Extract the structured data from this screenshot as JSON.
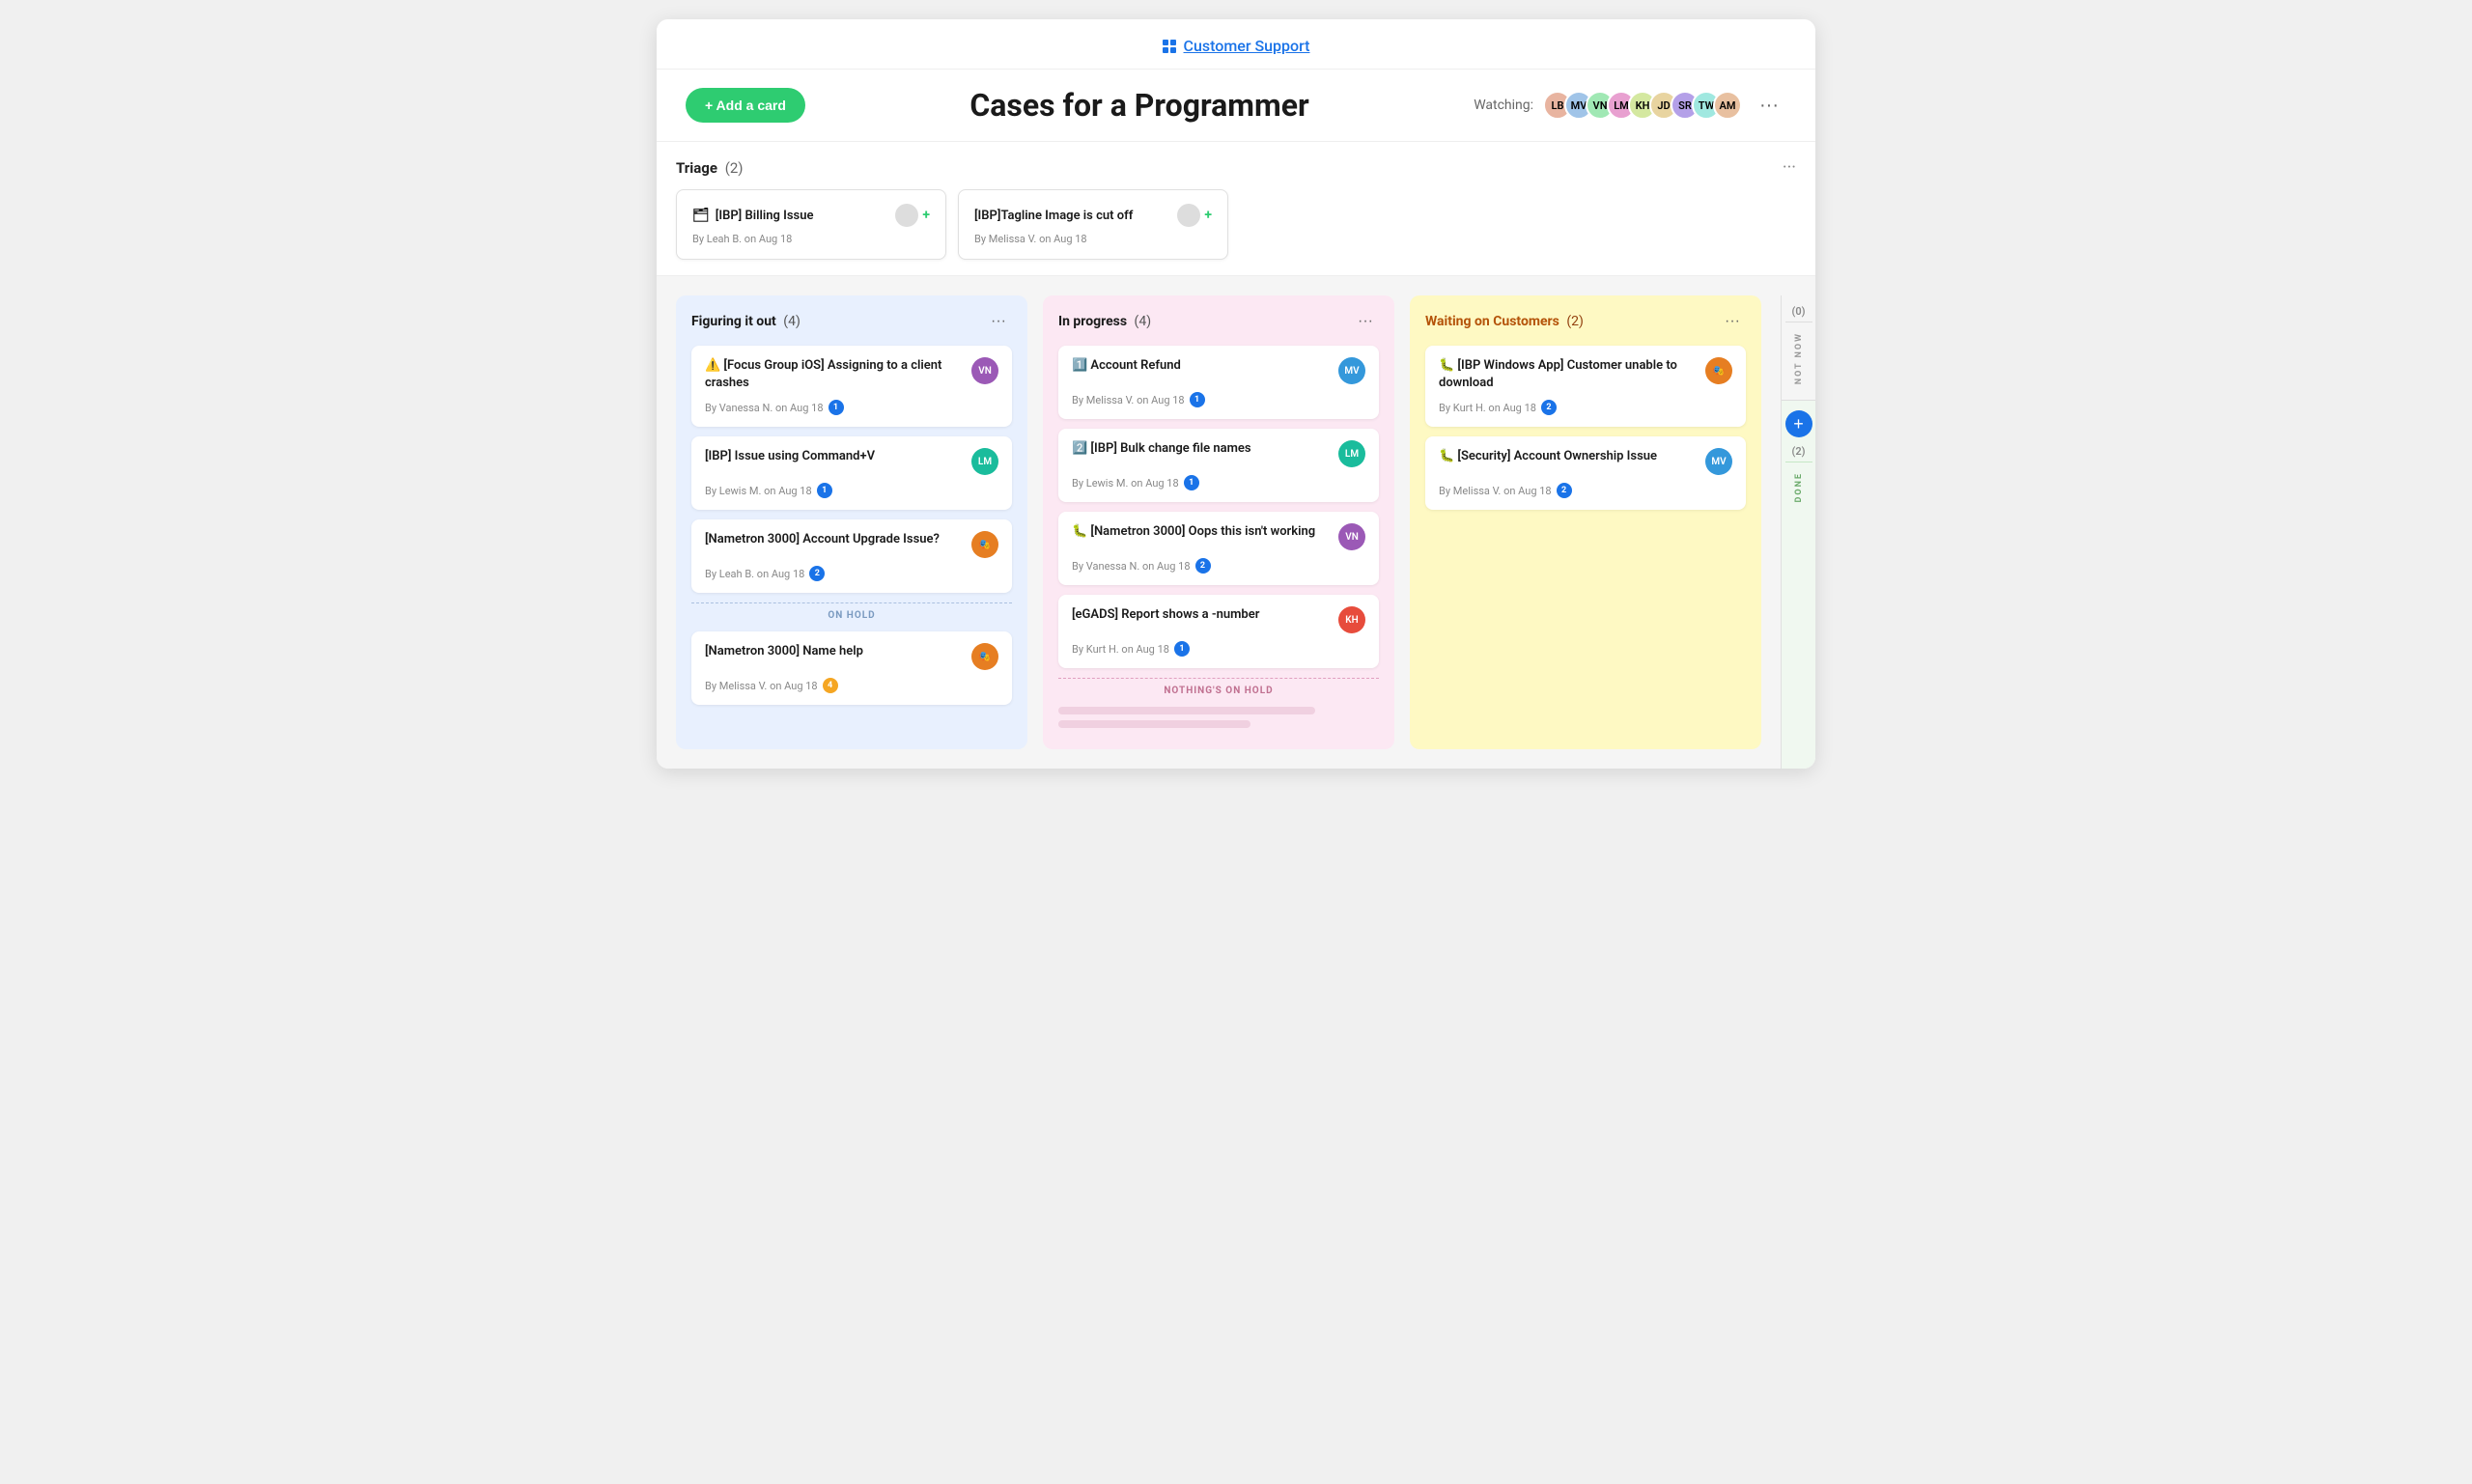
{
  "topNav": {
    "label": "Customer Support",
    "icon": "grid-icon"
  },
  "header": {
    "addCardLabel": "+ Add a card",
    "title": "Cases for a Programmer",
    "watchingLabel": "Watching:",
    "moreButtonLabel": "···"
  },
  "triage": {
    "title": "Triage",
    "count": "(2)",
    "cards": [
      {
        "icon": "🗂",
        "title": "[IBP] Billing Issue",
        "meta": "By Leah B. on Aug 18"
      },
      {
        "icon": "",
        "title": "[IBP]Tagline Image is cut off",
        "meta": "By Melissa V. on Aug 18"
      }
    ]
  },
  "columns": [
    {
      "id": "figuring",
      "title": "Figuring it out",
      "count": "(4)",
      "color": "blue",
      "cards": [
        {
          "icon": "⚠️",
          "title": "[Focus Group iOS] Assigning to a client crashes",
          "meta": "By Vanessa N. on Aug 18",
          "badge": "1",
          "badgeColor": "blue"
        },
        {
          "icon": "",
          "title": "[IBP] Issue using Command+V",
          "meta": "By Lewis M. on Aug 18",
          "badge": "1",
          "badgeColor": "blue"
        },
        {
          "icon": "",
          "title": "[Nametron 3000] Account Upgrade Issue?",
          "meta": "By Leah B. on Aug 18",
          "badge": "2",
          "badgeColor": "blue"
        }
      ],
      "onHold": true,
      "holdCards": [
        {
          "icon": "",
          "title": "[Nametron 3000] Name help",
          "meta": "By Melissa V. on Aug 18",
          "badge": "4",
          "badgeColor": "orange"
        }
      ]
    },
    {
      "id": "inprogress",
      "title": "In progress",
      "count": "(4)",
      "color": "pink",
      "cards": [
        {
          "icon": "1️⃣",
          "title": "Account Refund",
          "meta": "By Melissa V. on Aug 18",
          "badge": "1",
          "badgeColor": "blue"
        },
        {
          "icon": "2️⃣",
          "title": "[IBP] Bulk change file names",
          "meta": "By Lewis M. on Aug 18",
          "badge": "1",
          "badgeColor": "blue"
        },
        {
          "icon": "🐛",
          "title": "[Nametron 3000] Oops this isn't working",
          "meta": "By Vanessa N. on Aug 18",
          "badge": "2",
          "badgeColor": "blue"
        },
        {
          "icon": "",
          "title": "[eGADS] Report shows a -number",
          "meta": "By Kurt H. on Aug 18",
          "badge": "1",
          "badgeColor": "blue"
        }
      ],
      "nothingOnHold": true
    },
    {
      "id": "waiting",
      "title": "Waiting on Customers",
      "count": "(2)",
      "color": "yellow",
      "cards": [
        {
          "icon": "🐛",
          "title": "[IBP Windows App] Customer unable to download",
          "meta": "By Kurt H. on Aug 18",
          "badge": "2",
          "badgeColor": "blue"
        },
        {
          "icon": "🐛",
          "title": "[Security] Account Ownership Issue",
          "meta": "By Melissa V. on Aug 18",
          "badge": "2",
          "badgeColor": "blue"
        }
      ]
    }
  ],
  "sidebar": {
    "notNow": {
      "count": "(0)",
      "label": "NOT NOW"
    },
    "done": {
      "count": "(2)",
      "label": "DONE",
      "plusLabel": "+"
    }
  }
}
